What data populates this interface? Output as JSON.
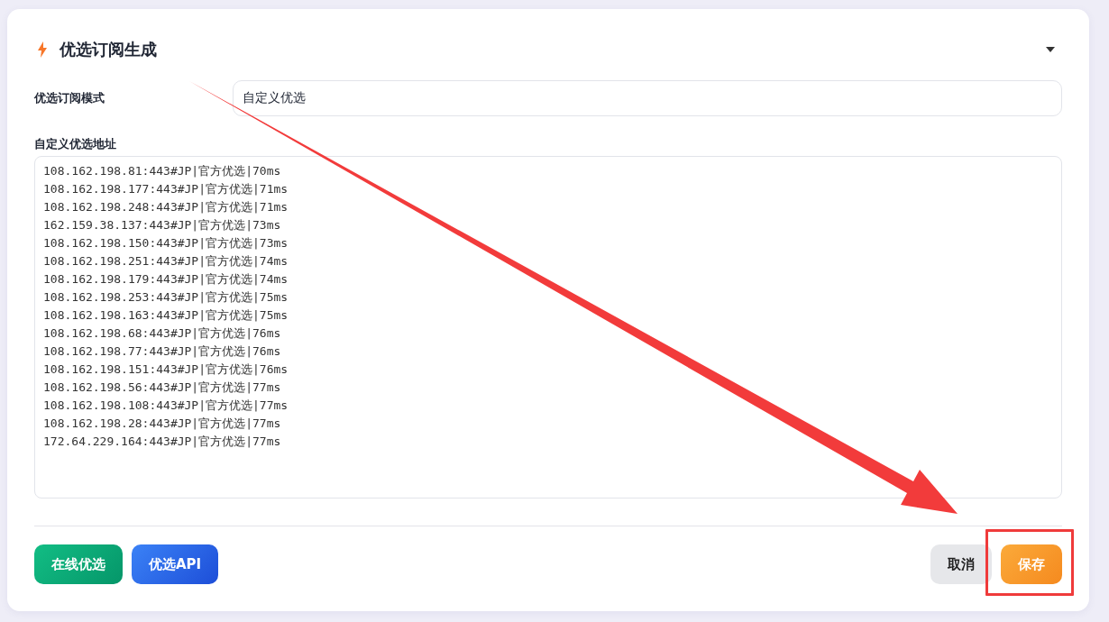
{
  "panel": {
    "title": "优选订阅生成",
    "expanded": true
  },
  "mode_field": {
    "label": "优选订阅模式",
    "value": "自定义优选"
  },
  "address_field": {
    "label": "自定义优选地址",
    "lines": [
      "108.162.198.81:443#JP|官方优选|70ms",
      "108.162.198.177:443#JP|官方优选|71ms",
      "108.162.198.248:443#JP|官方优选|71ms",
      "162.159.38.137:443#JP|官方优选|73ms",
      "108.162.198.150:443#JP|官方优选|73ms",
      "108.162.198.251:443#JP|官方优选|74ms",
      "108.162.198.179:443#JP|官方优选|74ms",
      "108.162.198.253:443#JP|官方优选|75ms",
      "108.162.198.163:443#JP|官方优选|75ms",
      "108.162.198.68:443#JP|官方优选|76ms",
      "108.162.198.77:443#JP|官方优选|76ms",
      "108.162.198.151:443#JP|官方优选|76ms",
      "108.162.198.56:443#JP|官方优选|77ms",
      "108.162.198.108:443#JP|官方优选|77ms",
      "108.162.198.28:443#JP|官方优选|77ms",
      "172.64.229.164:443#JP|官方优选|77ms"
    ]
  },
  "left_buttons": [
    {
      "label": "在线优选",
      "kind": "green"
    },
    {
      "label": "优选API",
      "kind": "blue"
    }
  ],
  "right_buttons": [
    {
      "label": "取消",
      "kind": "secondary"
    },
    {
      "label": "保存",
      "kind": "primary"
    }
  ]
}
